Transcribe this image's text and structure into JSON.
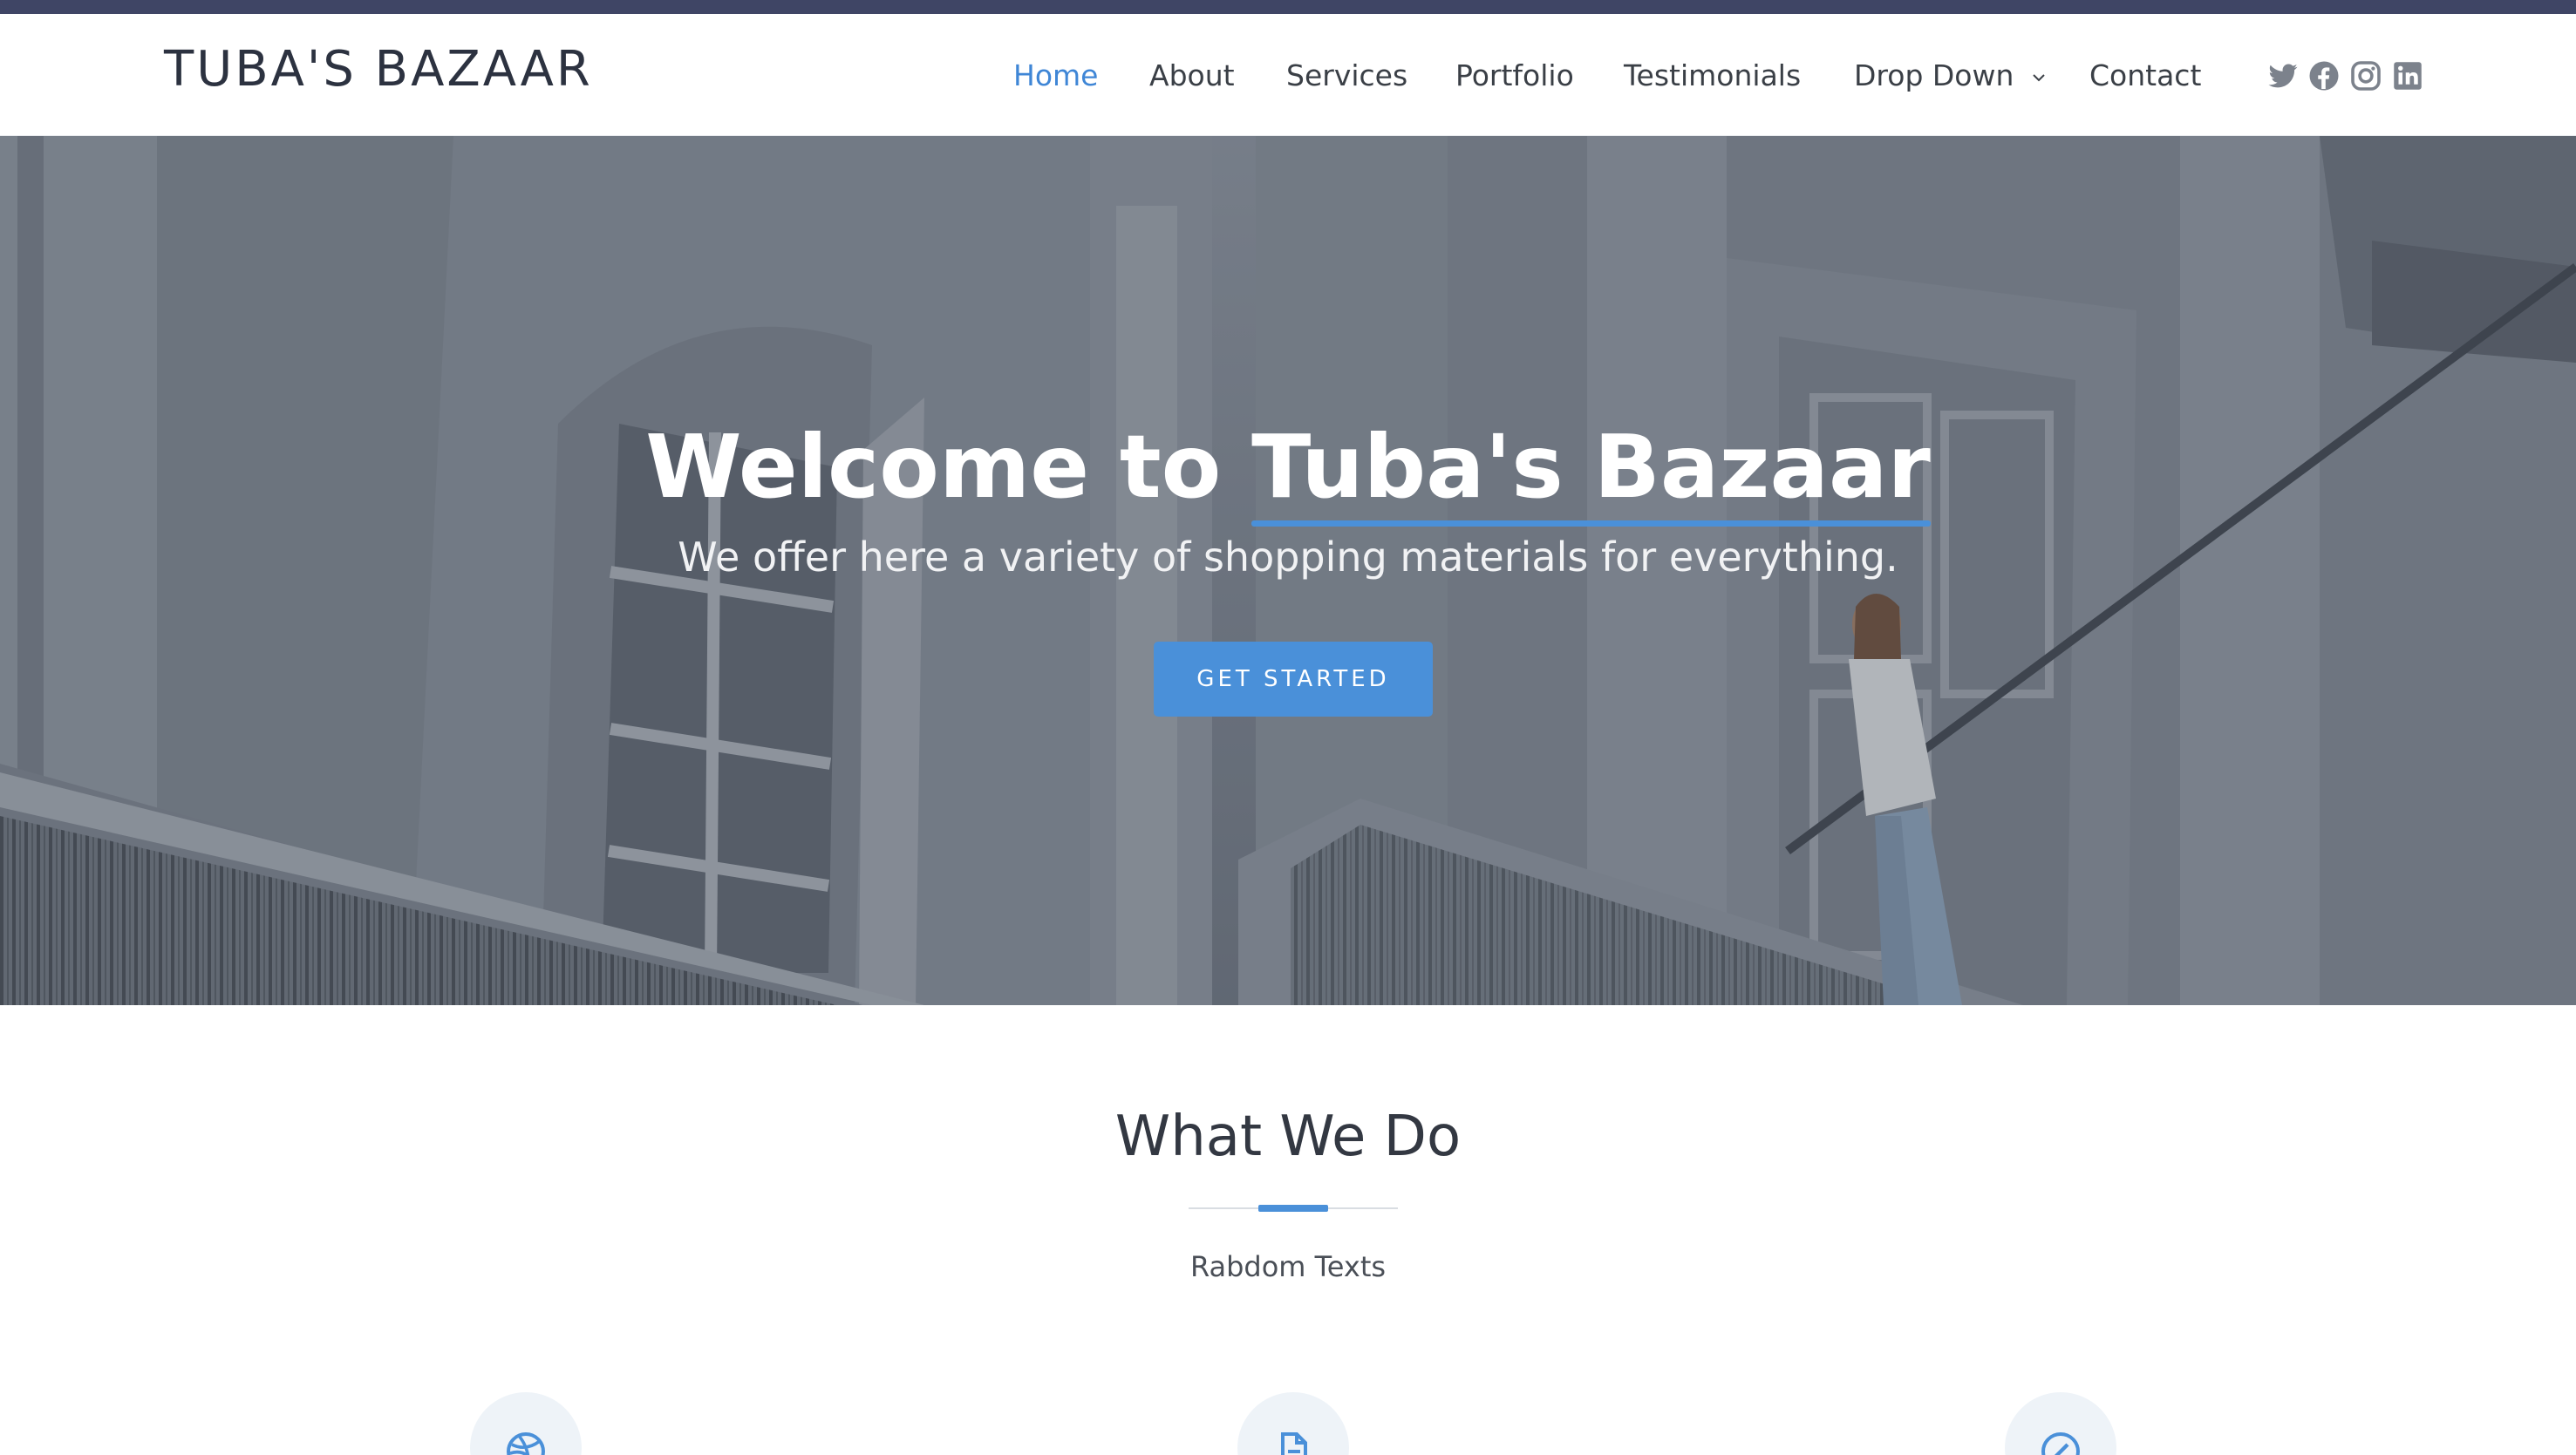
{
  "header": {
    "logo": "TUBA'S BAZAAR",
    "nav": [
      {
        "label": "Home",
        "active": true
      },
      {
        "label": "About"
      },
      {
        "label": "Services"
      },
      {
        "label": "Portfolio"
      },
      {
        "label": "Testimonials"
      },
      {
        "label": "Drop Down"
      },
      {
        "label": "Contact"
      }
    ],
    "social": [
      "twitter-icon",
      "facebook-icon",
      "instagram-icon",
      "linkedin-icon"
    ]
  },
  "hero": {
    "title_prefix": "Welcome to",
    "title_brand": "Tuba's Bazaar",
    "subtitle": "We offer here a variety of shopping materials for everything.",
    "button_label": "GET STARTED"
  },
  "section": {
    "title": "What We Do",
    "subtitle": "Rabdom Texts",
    "feature_icons": [
      "dribbble-icon",
      "document-icon",
      "compass-icon"
    ]
  },
  "colors": {
    "accent": "#4a90d9",
    "topbar": "#3f4565",
    "active_nav": "#3f86d6",
    "text": "#3a3f46"
  }
}
